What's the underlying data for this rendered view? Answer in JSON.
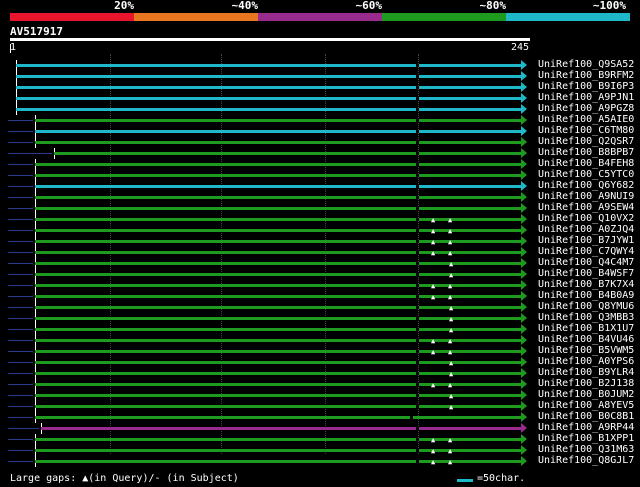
{
  "legend": [
    {
      "label": "20%",
      "color": "#e8152c"
    },
    {
      "label": "~40%",
      "color": "#e8761e"
    },
    {
      "label": "~60%",
      "color": "#9a2b8e"
    },
    {
      "label": "~80%",
      "color": "#1e9a1e"
    },
    {
      "label": "~100%",
      "color": "#1fb8c8"
    }
  ],
  "query": {
    "id": "AV517917",
    "start": "1",
    "end": "245"
  },
  "hits": [
    {
      "name": "UniRef100_Q9SA52",
      "color": "#1fb8c8",
      "gaps": []
    },
    {
      "name": "UniRef100_B9RFM2",
      "color": "#1fb8c8",
      "gaps": []
    },
    {
      "name": "UniRef100_B9I6P3",
      "color": "#1fb8c8",
      "gaps": []
    },
    {
      "name": "UniRef100_A9PJN1",
      "color": "#1fb8c8",
      "gaps": []
    },
    {
      "name": "UniRef100_A9PGZ8",
      "color": "#1fb8c8",
      "gaps": []
    },
    {
      "name": "UniRef100_A5AIE0",
      "color": "#1e9a1e",
      "gaps": []
    },
    {
      "name": "UniRef100_C6TM80",
      "color": "#1fb8c8",
      "gaps": []
    },
    {
      "name": "UniRef100_Q2QSR7",
      "color": "#1e9a1e",
      "gaps": []
    },
    {
      "name": "UniRef100_B8BPB7",
      "color": "#1e9a1e",
      "gaps": []
    },
    {
      "name": "UniRef100_B4FEH8",
      "color": "#1e9a1e",
      "gaps": []
    },
    {
      "name": "UniRef100_C5YTC0",
      "color": "#1e9a1e",
      "gaps": []
    },
    {
      "name": "UniRef100_Q6Y682",
      "color": "#1fb8c8",
      "gaps": []
    },
    {
      "name": "UniRef100_A9NUI9",
      "color": "#1e9a1e",
      "gaps": []
    },
    {
      "name": "UniRef100_A9SEW4",
      "color": "#1e9a1e",
      "gaps": []
    },
    {
      "name": "UniRef100_Q10VX2",
      "color": "#1e9a1e",
      "gaps": [
        "q",
        "q"
      ]
    },
    {
      "name": "UniRef100_A0ZJQ4",
      "color": "#1e9a1e",
      "gaps": [
        "q",
        "q"
      ]
    },
    {
      "name": "UniRef100_B7JYW1",
      "color": "#1e9a1e",
      "gaps": [
        "q",
        "q"
      ]
    },
    {
      "name": "UniRef100_C7QWY4",
      "color": "#1e9a1e",
      "gaps": [
        "q",
        "q"
      ]
    },
    {
      "name": "UniRef100_Q4C4M7",
      "color": "#1e9a1e",
      "gaps": [
        "q"
      ]
    },
    {
      "name": "UniRef100_B4WSF7",
      "color": "#1e9a1e",
      "gaps": [
        "q"
      ]
    },
    {
      "name": "UniRef100_B7K7X4",
      "color": "#1e9a1e",
      "gaps": [
        "q",
        "q"
      ]
    },
    {
      "name": "UniRef100_B4B0A9",
      "color": "#1e9a1e",
      "gaps": [
        "q",
        "q"
      ]
    },
    {
      "name": "UniRef100_Q8YMU6",
      "color": "#1e9a1e",
      "gaps": [
        "q"
      ]
    },
    {
      "name": "UniRef100_Q3MBB3",
      "color": "#1e9a1e",
      "gaps": [
        "q"
      ]
    },
    {
      "name": "UniRef100_B1X1U7",
      "color": "#1e9a1e",
      "gaps": [
        "q"
      ]
    },
    {
      "name": "UniRef100_B4VU46",
      "color": "#1e9a1e",
      "gaps": [
        "q",
        "q"
      ]
    },
    {
      "name": "UniRef100_B5VWM5",
      "color": "#1e9a1e",
      "gaps": [
        "q",
        "q"
      ]
    },
    {
      "name": "UniRef100_A0YPS6",
      "color": "#1e9a1e",
      "gaps": [
        "q"
      ]
    },
    {
      "name": "UniRef100_B9YLR4",
      "color": "#1e9a1e",
      "gaps": [
        "q"
      ]
    },
    {
      "name": "UniRef100_B2J138",
      "color": "#1e9a1e",
      "gaps": [
        "q",
        "q"
      ]
    },
    {
      "name": "UniRef100_B0JUM2",
      "color": "#1e9a1e",
      "gaps": [
        "q"
      ]
    },
    {
      "name": "UniRef100_A8YEV5",
      "color": "#1e9a1e",
      "gaps": [
        "q"
      ]
    },
    {
      "name": "UniRef100_B0C8B1",
      "color": "#1e9a1e",
      "gaps": []
    },
    {
      "name": "UniRef100_A9RP44",
      "color": "#9a2b8e",
      "gaps": []
    },
    {
      "name": "UniRef100_B1XPP1",
      "color": "#1e9a1e",
      "gaps": [
        "q",
        "q"
      ]
    },
    {
      "name": "UniRef100_Q31M63",
      "color": "#1e9a1e",
      "gaps": [
        "q",
        "q"
      ]
    },
    {
      "name": "UniRef100_Q8GJL7",
      "color": "#1e9a1e",
      "gaps": [
        "q",
        "q"
      ]
    }
  ],
  "footer": {
    "gaps_text": "Large gaps: ▲(in Query)/- (in Subject)",
    "scale_text": "=50char."
  }
}
